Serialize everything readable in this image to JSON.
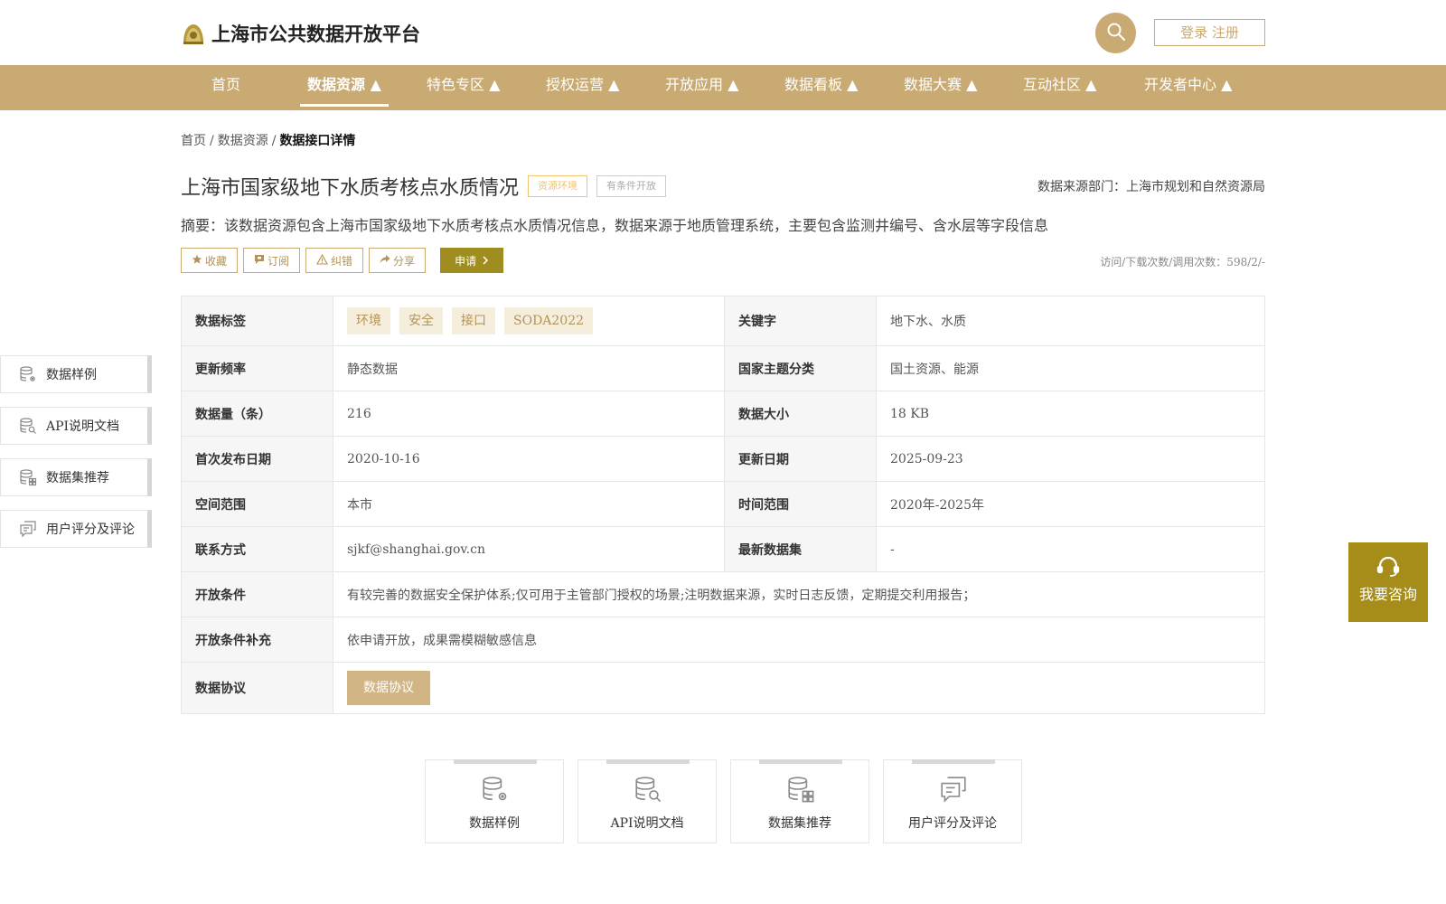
{
  "header": {
    "site_title": "上海市公共数据开放平台",
    "auth_label": "登录 注册"
  },
  "nav": {
    "items": [
      {
        "label": "首页"
      },
      {
        "label": "数据资源 ▲"
      },
      {
        "label": "特色专区 ▲"
      },
      {
        "label": "授权运营 ▲"
      },
      {
        "label": "开放应用 ▲"
      },
      {
        "label": "数据看板 ▲"
      },
      {
        "label": "数据大赛 ▲"
      },
      {
        "label": "互动社区 ▲"
      },
      {
        "label": "开发者中心 ▲"
      }
    ],
    "active_index": 1
  },
  "breadcrumb": {
    "home": "首页",
    "section": "数据资源",
    "current": "数据接口详情",
    "separator": "/"
  },
  "dataset": {
    "title": "上海市国家级地下水质考核点水质情况",
    "badge_env": "资源环境",
    "badge_open": "有条件开放",
    "source_dept": "数据来源部门：上海市规划和自然资源局",
    "summary": "摘要：该数据资源包含上海市国家级地下水质考核点水质情况信息，数据来源于地质管理系统，主要包含监测井编号、含水层等字段信息",
    "stats": "访问/下载次数/调用次数：598/2/-"
  },
  "actions": {
    "collect": "收藏",
    "subscribe": "订阅",
    "correct": "纠错",
    "share": "分享",
    "apply": "申请"
  },
  "table": {
    "tags_label": "数据标签",
    "tags": [
      "环境",
      "安全",
      "接口",
      "SODA2022"
    ],
    "keywords_label": "关键字",
    "keywords": "地下水、水质",
    "freq_label": "更新频率",
    "freq": "静态数据",
    "theme_label": "国家主题分类",
    "theme": "国土资源、能源",
    "count_label": "数据量（条）",
    "count": "216",
    "size_label": "数据大小",
    "size": "18 KB",
    "first_pub_label": "首次发布日期",
    "first_pub": "2020-10-16",
    "update_label": "更新日期",
    "update": "2025-09-23",
    "space_label": "空间范围",
    "space": "本市",
    "time_label": "时间范围",
    "time": "2020年-2025年",
    "contact_label": "联系方式",
    "contact": "sjkf@shanghai.gov.cn",
    "latest_label": "最新数据集",
    "latest": "-",
    "open_cond_label": "开放条件",
    "open_cond": "有较完善的数据安全保护体系;仅可用于主管部门授权的场景;注明数据来源，实时日志反馈，定期提交利用报告；",
    "open_cond_extra_label": "开放条件补充",
    "open_cond_extra": "依申请开放，成果需模糊敏感信息",
    "agreement_label": "数据协议",
    "agreement_btn": "数据协议"
  },
  "side_nav": [
    {
      "label": "数据样例",
      "icon": "database-gear-icon"
    },
    {
      "label": "API说明文档",
      "icon": "database-search-icon"
    },
    {
      "label": "数据集推荐",
      "icon": "database-grid-icon"
    },
    {
      "label": "用户评分及评论",
      "icon": "comment-icon"
    }
  ],
  "cards": [
    {
      "label": "数据样例",
      "icon": "database-gear-icon"
    },
    {
      "label": "API说明文档",
      "icon": "database-search-icon"
    },
    {
      "label": "数据集推荐",
      "icon": "database-grid-icon"
    },
    {
      "label": "用户评分及评论",
      "icon": "comment-icon"
    }
  ],
  "consult": {
    "label": "我要咨询",
    "icon": "headset-icon"
  },
  "colors": {
    "brand": "#c8aa72",
    "apply": "#a08d1f",
    "consult": "#a68d1a"
  }
}
